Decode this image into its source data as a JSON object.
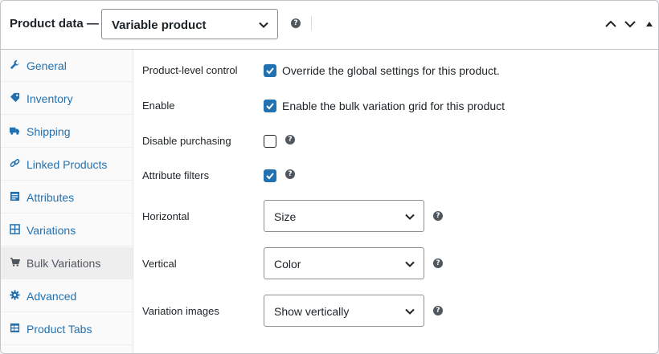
{
  "header": {
    "title": "Product data —",
    "product_type": "Variable product",
    "help": "?"
  },
  "sidebar": {
    "items": [
      {
        "label": "General",
        "icon": "wrench-icon"
      },
      {
        "label": "Inventory",
        "icon": "tag-icon"
      },
      {
        "label": "Shipping",
        "icon": "truck-icon"
      },
      {
        "label": "Linked Products",
        "icon": "link-icon"
      },
      {
        "label": "Attributes",
        "icon": "list-icon"
      },
      {
        "label": "Variations",
        "icon": "grid-icon"
      },
      {
        "label": "Bulk Variations",
        "icon": "cart-icon",
        "active": true
      },
      {
        "label": "Advanced",
        "icon": "gear-icon"
      },
      {
        "label": "Product Tabs",
        "icon": "table-icon"
      }
    ]
  },
  "settings": {
    "product_level": {
      "label": "Product-level control",
      "checked": true,
      "text": "Override the global settings for this product."
    },
    "enable": {
      "label": "Enable",
      "checked": true,
      "text": "Enable the bulk variation grid for this product"
    },
    "disable_purchasing": {
      "label": "Disable purchasing",
      "checked": false
    },
    "attribute_filters": {
      "label": "Attribute filters",
      "checked": true
    },
    "horizontal": {
      "label": "Horizontal",
      "value": "Size"
    },
    "vertical": {
      "label": "Vertical",
      "value": "Color"
    },
    "variation_images": {
      "label": "Variation images",
      "value": "Show vertically"
    }
  },
  "colors": {
    "accent": "#2271b1",
    "link": "#2271b1",
    "text": "#1d2327"
  }
}
